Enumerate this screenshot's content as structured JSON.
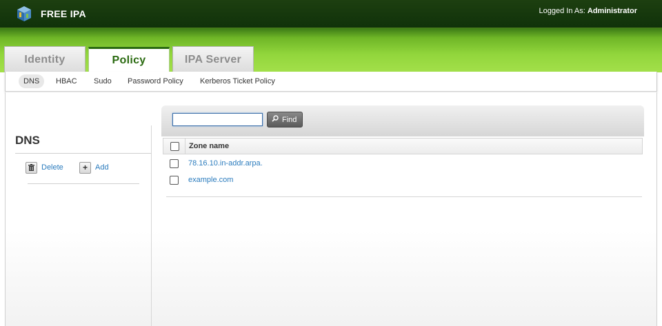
{
  "header": {
    "brand": "FREE IPA",
    "logged_in_label": "Logged In As:",
    "user": "Administrator",
    "logo_icon": "freeipa-logo-icon"
  },
  "tabs": [
    {
      "label": "Identity",
      "active": false
    },
    {
      "label": "Policy",
      "active": true
    },
    {
      "label": "IPA Server",
      "active": false
    }
  ],
  "subnav": [
    {
      "label": "DNS",
      "active": true
    },
    {
      "label": "HBAC",
      "active": false
    },
    {
      "label": "Sudo",
      "active": false
    },
    {
      "label": "Password Policy",
      "active": false
    },
    {
      "label": "Kerberos Ticket Policy",
      "active": false
    }
  ],
  "left_panel": {
    "title": "DNS",
    "actions": {
      "delete": {
        "label": "Delete",
        "icon": "trash-icon"
      },
      "add": {
        "label": "Add",
        "icon": "plus-icon"
      }
    }
  },
  "search": {
    "value": "",
    "placeholder": "",
    "button_label": "Find",
    "button_icon": "magnifier-icon"
  },
  "table": {
    "columns": [
      "Zone name"
    ],
    "rows": [
      {
        "zone_name": "78.16.10.in-addr.arpa.",
        "checked": false
      },
      {
        "zone_name": "example.com",
        "checked": false
      }
    ]
  },
  "colors": {
    "header_bg": "#163a0c",
    "band_green": "#92d63c",
    "active_tab_text": "#2a6a10",
    "link": "#2a7bbd"
  }
}
